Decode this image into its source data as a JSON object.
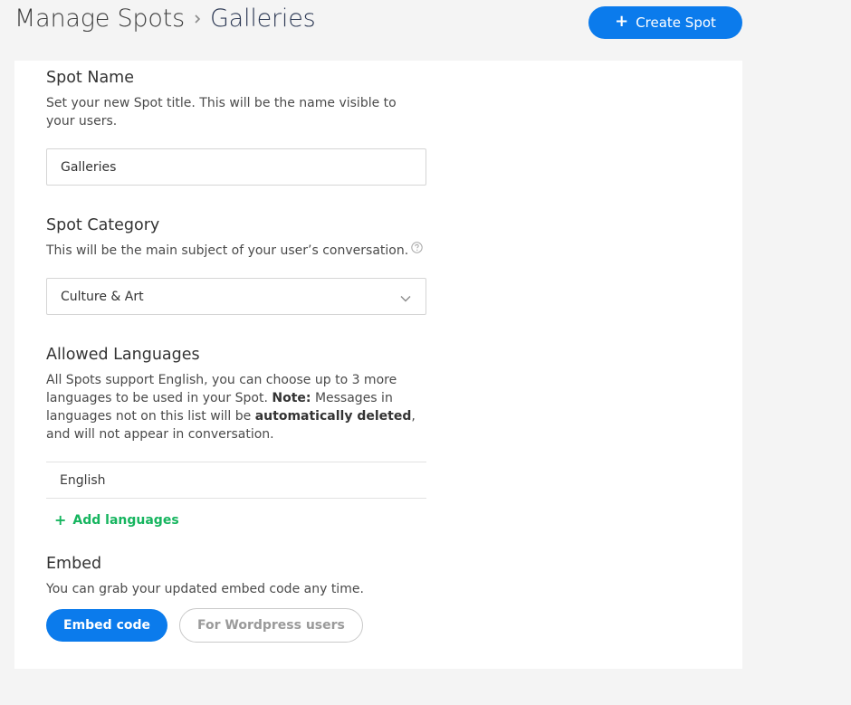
{
  "header": {
    "breadcrumb_root": "Manage Spots",
    "breadcrumb_current": "Galleries",
    "create_button_label": "Create Spot"
  },
  "spot_name": {
    "title": "Spot Name",
    "description": "Set your new Spot title. This will be the name visible to your users.",
    "value": "Galleries"
  },
  "spot_category": {
    "title": "Spot Category",
    "description": "This will be the main subject of your user’s conversation.",
    "selected": "Culture & Art"
  },
  "languages": {
    "title": "Allowed Languages",
    "desc_part1": "All Spots support English, you can choose up to 3 more languages to be used in your Spot. ",
    "desc_note": "Note:",
    "desc_part2": " Messages in languages not on this list will be ",
    "desc_bold": "automatically deleted",
    "desc_part3": ", and will not appear in conversation.",
    "items": [
      "English"
    ],
    "add_label": "Add languages"
  },
  "embed": {
    "title": "Embed",
    "description": "You can grab your updated embed code any time.",
    "embed_button": "Embed code",
    "wordpress_button": "For Wordpress users"
  },
  "colors": {
    "primary": "#0b7bec",
    "add_green": "#16b55f",
    "page_bg": "#f4f4f4"
  }
}
